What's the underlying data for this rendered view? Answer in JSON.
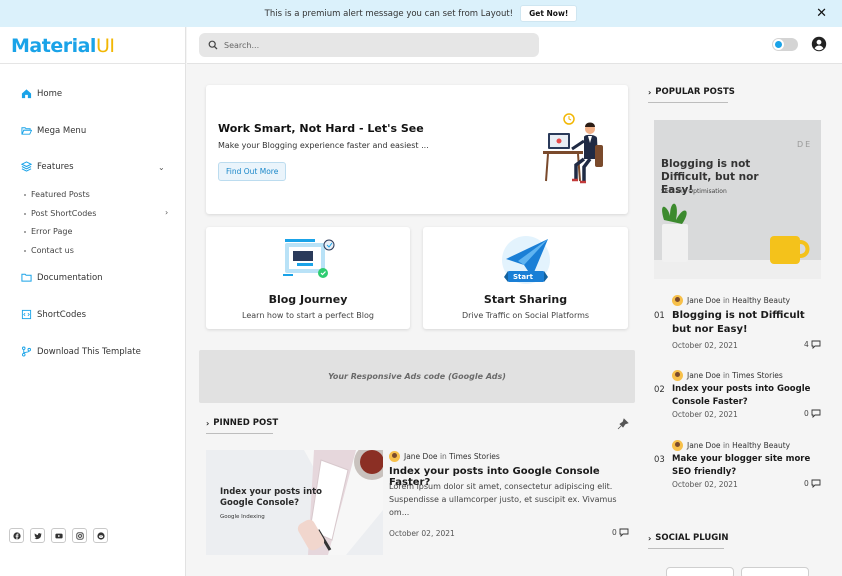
{
  "alert": {
    "message": "This is a premium alert message you can set from Layout!",
    "button": "Get Now!",
    "close": "✕"
  },
  "logo": {
    "part1": "M",
    "part2": "aterial",
    "part3": "UI"
  },
  "sidebar": {
    "items": [
      {
        "label": "Home",
        "icon": "home-icon"
      },
      {
        "label": "Mega Menu",
        "icon": "folder-open-icon"
      },
      {
        "label": "Features",
        "icon": "layers-icon"
      },
      {
        "label": "Documentation",
        "icon": "folder-icon"
      },
      {
        "label": "ShortCodes",
        "icon": "code-icon"
      },
      {
        "label": "Download This Template",
        "icon": "git-branch-icon"
      }
    ],
    "sub_items": [
      "Featured Posts",
      "Post ShortCodes",
      "Error Page",
      "Contact us"
    ],
    "socials": [
      "facebook-icon",
      "twitter-icon",
      "youtube-icon",
      "instagram-icon",
      "reddit-icon"
    ]
  },
  "search": {
    "placeholder": "Search..."
  },
  "hero": {
    "title": "Work Smart, Not Hard - Let's See",
    "subtitle": "Make your Blogging experience faster and easiest ...",
    "button": "Find Out More"
  },
  "features": [
    {
      "title": "Blog Journey",
      "subtitle": "Learn how to start a perfect Blog"
    },
    {
      "title": "Start Sharing",
      "subtitle": "Drive Traffic on Social Platforms",
      "badge": "Start"
    }
  ],
  "ads": {
    "text": "Your Responsive Ads code (Google Ads)"
  },
  "pinned": {
    "heading": "PINNED POST",
    "image_title": "Index your posts into Google Console?",
    "image_tag": "Google Indexing",
    "author": "Jane Doe",
    "in": "in",
    "category": "Times Stories",
    "title": "Index your posts into Google Console Faster?",
    "excerpt": "Lorem ipsum dolor sit amet, consectetur adipiscing elit. Suspendisse a ullamcorper justo, et suscipit ex. Vivamus om...",
    "date": "October 02, 2021",
    "comments": "0"
  },
  "popular": {
    "heading": "POPULAR POSTS",
    "image_title": "Blogging is not Difficult, but nor Easy!",
    "image_tag": "SEO and Optimisation",
    "image_corner": "DE",
    "posts": [
      {
        "num": "01",
        "author": "Jane Doe",
        "in": "in",
        "category": "Healthy Beauty",
        "title": "Blogging is not Difficult but nor Easy!",
        "date": "October 02, 2021",
        "comments": "4"
      },
      {
        "num": "02",
        "author": "Jane Doe",
        "in": "in",
        "category": "Times Stories",
        "title": "Index your posts into Google Console Faster?",
        "date": "October 02, 2021",
        "comments": "0"
      },
      {
        "num": "03",
        "author": "Jane Doe",
        "in": "in",
        "category": "Healthy Beauty",
        "title": "Make your blogger site more SEO friendly?",
        "date": "October 02, 2021",
        "comments": "0"
      }
    ]
  },
  "social": {
    "heading": "SOCIAL PLUGIN"
  },
  "colors": {
    "accent": "#1aa3e8",
    "logo_ui": "#f2b705",
    "alert_bg": "#dbf1fb"
  }
}
